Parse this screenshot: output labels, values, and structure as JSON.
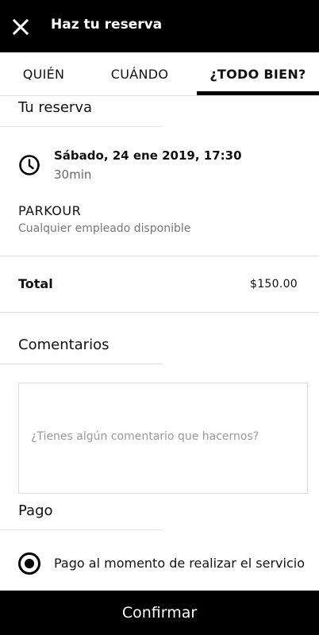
{
  "header": {
    "title": "Haz tu reserva",
    "close_icon": "close-icon"
  },
  "tabs": [
    {
      "label": "QUIÉN",
      "active": false
    },
    {
      "label": "CUÁNDO",
      "active": false
    },
    {
      "label": "¿TODO BIEN?",
      "active": true
    }
  ],
  "booking": {
    "section_title": "Tu reserva",
    "date": "Sábado, 24 ene 2019, 17:30",
    "duration": "30min",
    "service": "PARKOUR",
    "employee": "Cualquier empleado disponible",
    "total_label": "Total",
    "total_value": "$150.00"
  },
  "comments": {
    "section_title": "Comentarios",
    "value": "",
    "placeholder": "¿Tienes algún comentario que hacernos?"
  },
  "payment": {
    "section_title": "Pago",
    "options": [
      {
        "label": "Pago al momento de realizar el servicio",
        "selected": true
      }
    ]
  },
  "footer": {
    "confirm_label": "Confirmar"
  },
  "colors": {
    "primary": "#000000",
    "background": "#ffffff",
    "divider": "#e2e2e2",
    "muted_text": "#777777"
  }
}
